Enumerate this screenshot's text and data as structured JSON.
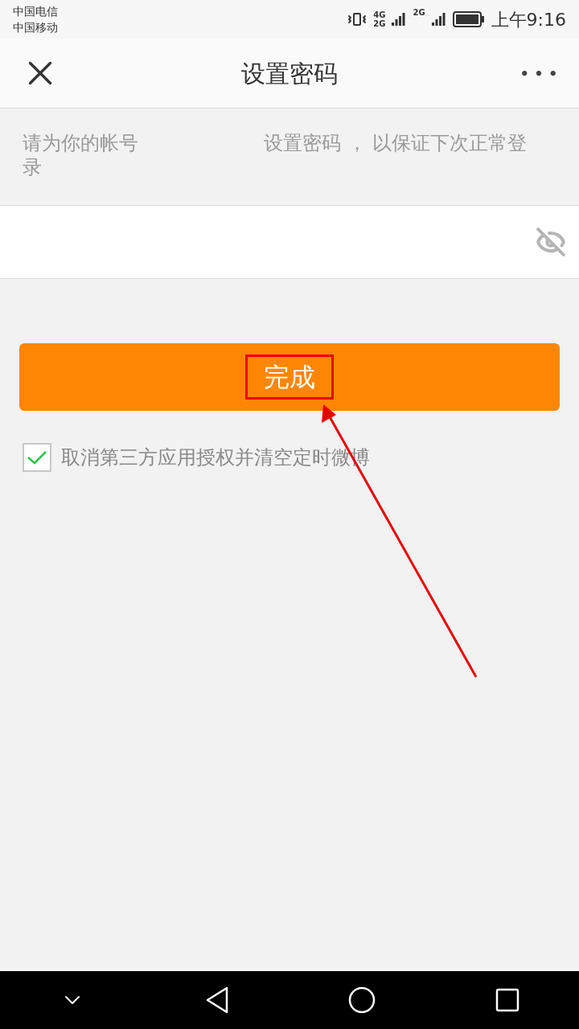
{
  "status_bar": {
    "carriers": [
      "中国电信",
      "中国移动"
    ],
    "network_labels": [
      "4G",
      "2G",
      "2G"
    ],
    "time": "上午9:16"
  },
  "header": {
    "title": "设置密码",
    "more": "• • •"
  },
  "intro": {
    "parts": [
      "请为你的帐号",
      "设置密码 ， 以保证下次正常登",
      "录"
    ]
  },
  "password_field": {
    "masked": true
  },
  "done_button": {
    "label": "完成"
  },
  "option": {
    "label": "取消第三方应用授权并清空定时微博",
    "checked": true
  }
}
